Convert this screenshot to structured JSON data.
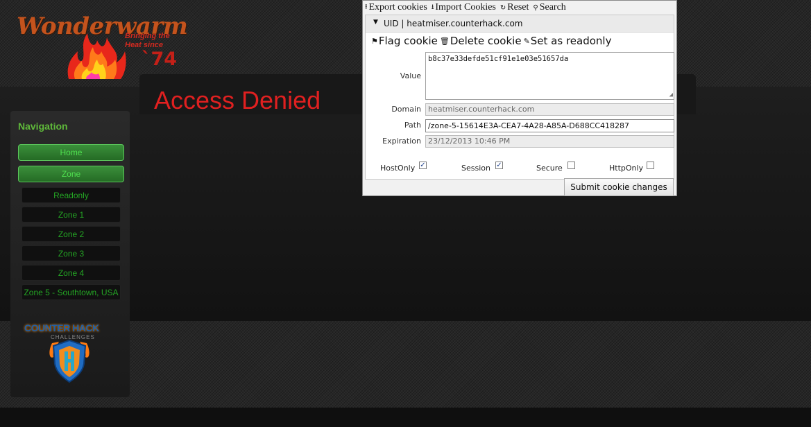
{
  "brand": {
    "logo_text": "Wonderwarm",
    "tagline": "Bringing the Heat since",
    "year": "`74"
  },
  "page": {
    "title": "Access Denied"
  },
  "nav": {
    "title": "Navigation",
    "items": [
      {
        "label": "Home",
        "active": true
      },
      {
        "label": "Zone",
        "active": true
      },
      {
        "label": "Readonly",
        "active": false
      },
      {
        "label": "Zone 1",
        "active": false
      },
      {
        "label": "Zone 2",
        "active": false
      },
      {
        "label": "Zone 3",
        "active": false
      },
      {
        "label": "Zone 4",
        "active": false
      },
      {
        "label": "Zone 5 - Southtown, USA",
        "active": false
      }
    ]
  },
  "sponsor": {
    "name": "COUNTER HACK",
    "subtitle": "CHALLENGES"
  },
  "cookie_editor": {
    "toolbar": {
      "export": "Export cookies",
      "import": "Import Cookies",
      "reset": "Reset",
      "search": "Search"
    },
    "cookie": {
      "header": "UID | heatmiser.counterhack.com",
      "actions": {
        "flag": "Flag cookie",
        "delete": "Delete cookie",
        "readonly": "Set as readonly"
      },
      "labels": {
        "value": "Value",
        "domain": "Domain",
        "path": "Path",
        "expiration": "Expiration"
      },
      "value": "b8c37e33defde51cf91e1e03e51657da",
      "domain": "heatmiser.counterhack.com",
      "path": "/zone-5-15614E3A-CEA7-4A28-A85A-D688CC418287",
      "expiration": "23/12/2013 10:46 PM",
      "flags": {
        "hostonly": {
          "label": "HostOnly",
          "checked": true
        },
        "session": {
          "label": "Session",
          "checked": true
        },
        "secure": {
          "label": "Secure",
          "checked": false
        },
        "httponly": {
          "label": "HttpOnly",
          "checked": false
        }
      }
    },
    "submit_label": "Submit cookie changes"
  },
  "colors": {
    "accent_green": "#2fc42f",
    "title_red": "#e02020",
    "brand_orange": "#c4531d"
  }
}
